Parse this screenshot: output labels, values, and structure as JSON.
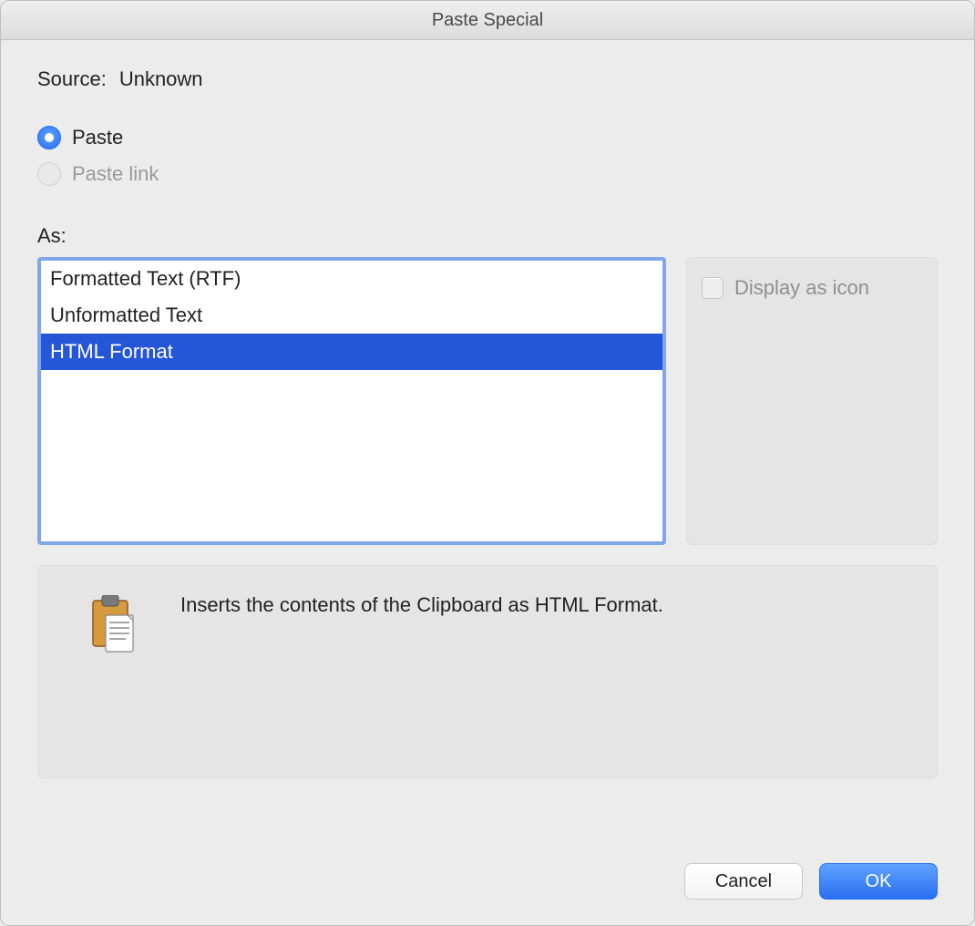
{
  "title": "Paste Special",
  "source": {
    "label": "Source:",
    "value": "Unknown"
  },
  "radio": {
    "paste": {
      "label": "Paste",
      "selected": true,
      "enabled": true
    },
    "paste_link": {
      "label": "Paste link",
      "selected": false,
      "enabled": false
    }
  },
  "as_label": "As:",
  "formats": {
    "items": [
      {
        "label": "Formatted Text (RTF)",
        "selected": false
      },
      {
        "label": "Unformatted Text",
        "selected": false
      },
      {
        "label": "HTML Format",
        "selected": true
      }
    ]
  },
  "display_as_icon": {
    "label": "Display as icon",
    "enabled": false,
    "checked": false
  },
  "description": "Inserts the contents of the Clipboard as HTML Format.",
  "buttons": {
    "cancel": "Cancel",
    "ok": "OK"
  }
}
